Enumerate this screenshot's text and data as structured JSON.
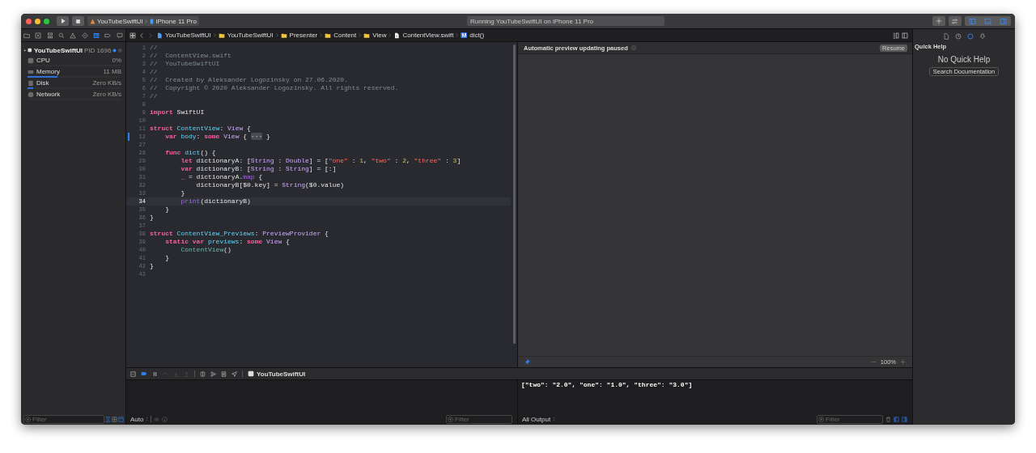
{
  "toolbar": {
    "scheme": {
      "target": "YouTubeSwiftUI",
      "device": "iPhone 11 Pro"
    },
    "activity": "Running YouTubeSwiftUI on iPhone 11 Pro",
    "panel_toggles": [
      {
        "kind": "left",
        "selected": true
      },
      {
        "kind": "bottom",
        "selected": true
      },
      {
        "kind": "right",
        "selected": true
      }
    ]
  },
  "navigator": {
    "tabs": [
      {
        "kind": "folder",
        "selected": false
      },
      {
        "kind": "source",
        "selected": false
      },
      {
        "kind": "symbol",
        "selected": false
      },
      {
        "kind": "search",
        "selected": false
      },
      {
        "kind": "issue",
        "selected": false
      },
      {
        "kind": "test",
        "selected": false
      },
      {
        "kind": "debug",
        "selected": true
      },
      {
        "kind": "breakpoint",
        "selected": false
      },
      {
        "kind": "report",
        "selected": false
      }
    ],
    "process": {
      "name": "YouTubeSwiftUI",
      "pid": "PID 1696"
    },
    "gauges": [
      {
        "kind": "cpu",
        "label": "CPU",
        "value": "0%"
      },
      {
        "kind": "memory",
        "label": "Memory",
        "value": "11 MB",
        "level": 0.32
      },
      {
        "kind": "disk",
        "label": "Disk",
        "value": "Zero KB/s",
        "level": 0.06
      },
      {
        "kind": "network",
        "label": "Network",
        "value": "Zero KB/s"
      }
    ],
    "filter": {
      "placeholder": "Filter"
    },
    "filter_toggles": [
      {
        "kind": "running",
        "selected": true
      },
      {
        "kind": "grid",
        "selected": false
      },
      {
        "kind": "window",
        "selected": true
      }
    ]
  },
  "editor": {
    "jump_bar": [
      {
        "kind": "project",
        "label": "YouTubeSwiftUI"
      },
      {
        "kind": "folder",
        "label": "YouTubeSwiftUI"
      },
      {
        "kind": "folder",
        "label": "Presenter"
      },
      {
        "kind": "folder",
        "label": "Content"
      },
      {
        "kind": "folder",
        "label": "View"
      },
      {
        "kind": "file",
        "label": "ContentView.swift"
      },
      {
        "kind": "method",
        "badge": "M",
        "label": "dict()"
      }
    ],
    "lines": [
      {
        "n": "1",
        "current": false,
        "changed": false,
        "tokens": [
          {
            "kind": "comment",
            "text": "//"
          }
        ]
      },
      {
        "n": "2",
        "current": false,
        "changed": false,
        "tokens": [
          {
            "kind": "comment",
            "text": "//  ContentView.swift"
          }
        ]
      },
      {
        "n": "3",
        "current": false,
        "changed": false,
        "tokens": [
          {
            "kind": "comment",
            "text": "//  YouTubeSwiftUI"
          }
        ]
      },
      {
        "n": "4",
        "current": false,
        "changed": false,
        "tokens": [
          {
            "kind": "comment",
            "text": "//"
          }
        ]
      },
      {
        "n": "5",
        "current": false,
        "changed": false,
        "tokens": [
          {
            "kind": "comment",
            "text": "//  Created by Aleksander Logozinsky on 27.06.2020."
          }
        ]
      },
      {
        "n": "6",
        "current": false,
        "changed": false,
        "tokens": [
          {
            "kind": "comment",
            "text": "//  Copyright © 2020 Aleksander Logozinsky. All rights reserved."
          }
        ]
      },
      {
        "n": "7",
        "current": false,
        "changed": false,
        "tokens": [
          {
            "kind": "comment",
            "text": "//"
          }
        ]
      },
      {
        "n": "8",
        "current": false,
        "changed": false
      },
      {
        "n": "9",
        "current": false,
        "changed": false,
        "tokens": [
          {
            "kind": "keyword",
            "text": "import "
          },
          {
            "kind": "plain",
            "text": "SwiftUI"
          }
        ]
      },
      {
        "n": "10",
        "current": false,
        "changed": false
      },
      {
        "n": "11",
        "current": false,
        "changed": false,
        "tokens": [
          {
            "kind": "keyword",
            "text": "struct "
          },
          {
            "kind": "decl",
            "text": "ContentView"
          },
          {
            "kind": "plain",
            "text": ": "
          },
          {
            "kind": "type",
            "text": "View"
          },
          {
            "kind": "plain",
            "text": " {"
          }
        ]
      },
      {
        "n": "12",
        "current": false,
        "changed": true,
        "tokens": [
          {
            "kind": "keyword",
            "text": "    var "
          },
          {
            "kind": "decl",
            "text": "body"
          },
          {
            "kind": "plain",
            "text": ": "
          },
          {
            "kind": "keyword",
            "text": "some "
          },
          {
            "kind": "type",
            "text": "View"
          },
          {
            "kind": "plain",
            "text": " { "
          },
          {
            "kind": "fold",
            "text": "···"
          },
          {
            "kind": "plain",
            "text": " }"
          }
        ]
      },
      {
        "n": "27",
        "current": false,
        "changed": false
      },
      {
        "n": "28",
        "current": false,
        "changed": false,
        "tokens": [
          {
            "kind": "keyword",
            "text": "    func "
          },
          {
            "kind": "decl",
            "text": "dict"
          },
          {
            "kind": "plain",
            "text": "() {"
          }
        ]
      },
      {
        "n": "29",
        "current": false,
        "changed": false,
        "tokens": [
          {
            "kind": "keyword",
            "text": "        let "
          },
          {
            "kind": "plain",
            "text": "dictionaryA: ["
          },
          {
            "kind": "type",
            "text": "String"
          },
          {
            "kind": "plain",
            "text": " : "
          },
          {
            "kind": "type",
            "text": "Double"
          },
          {
            "kind": "plain",
            "text": "] = ["
          },
          {
            "kind": "string",
            "text": "\"one\""
          },
          {
            "kind": "plain",
            "text": " : "
          },
          {
            "kind": "number",
            "text": "1"
          },
          {
            "kind": "plain",
            "text": ", "
          },
          {
            "kind": "string",
            "text": "\"two\""
          },
          {
            "kind": "plain",
            "text": " : "
          },
          {
            "kind": "number",
            "text": "2"
          },
          {
            "kind": "plain",
            "text": ", "
          },
          {
            "kind": "string",
            "text": "\"three\""
          },
          {
            "kind": "plain",
            "text": " : "
          },
          {
            "kind": "number",
            "text": "3"
          },
          {
            "kind": "plain",
            "text": "]"
          }
        ]
      },
      {
        "n": "30",
        "current": false,
        "changed": false,
        "tokens": [
          {
            "kind": "keyword",
            "text": "        var "
          },
          {
            "kind": "plain",
            "text": "dictionaryB: ["
          },
          {
            "kind": "type",
            "text": "String"
          },
          {
            "kind": "plain",
            "text": " : "
          },
          {
            "kind": "type",
            "text": "String"
          },
          {
            "kind": "plain",
            "text": "] = [:]"
          }
        ]
      },
      {
        "n": "31",
        "current": false,
        "changed": false,
        "tokens": [
          {
            "kind": "keyword",
            "text": "        _"
          },
          {
            "kind": "plain",
            "text": " = dictionaryA."
          },
          {
            "kind": "call",
            "text": "map"
          },
          {
            "kind": "plain",
            "text": " {"
          }
        ]
      },
      {
        "n": "32",
        "current": false,
        "changed": false,
        "tokens": [
          {
            "kind": "plain",
            "text": "            dictionaryB[$0.key] = "
          },
          {
            "kind": "type",
            "text": "String"
          },
          {
            "kind": "plain",
            "text": "($0.value)"
          }
        ]
      },
      {
        "n": "33",
        "current": false,
        "changed": false,
        "tokens": [
          {
            "kind": "plain",
            "text": "        }"
          }
        ]
      },
      {
        "n": "34",
        "current": true,
        "changed": false,
        "tokens": [
          {
            "kind": "call",
            "text": "        print"
          },
          {
            "kind": "plain",
            "text": "(dictionaryB)"
          }
        ]
      },
      {
        "n": "35",
        "current": false,
        "changed": false,
        "tokens": [
          {
            "kind": "plain",
            "text": "    }"
          }
        ]
      },
      {
        "n": "36",
        "current": false,
        "changed": false,
        "tokens": [
          {
            "kind": "plain",
            "text": "}"
          }
        ]
      },
      {
        "n": "37",
        "current": false,
        "changed": false
      },
      {
        "n": "38",
        "current": false,
        "changed": false,
        "tokens": [
          {
            "kind": "keyword",
            "text": "struct "
          },
          {
            "kind": "decl",
            "text": "ContentView_Previews"
          },
          {
            "kind": "plain",
            "text": ": "
          },
          {
            "kind": "type",
            "text": "PreviewProvider"
          },
          {
            "kind": "plain",
            "text": " {"
          }
        ]
      },
      {
        "n": "39",
        "current": false,
        "changed": false,
        "tokens": [
          {
            "kind": "keyword",
            "text": "    static var "
          },
          {
            "kind": "decl",
            "text": "previews"
          },
          {
            "kind": "plain",
            "text": ": "
          },
          {
            "kind": "keyword",
            "text": "some "
          },
          {
            "kind": "type",
            "text": "View"
          },
          {
            "kind": "plain",
            "text": " {"
          }
        ]
      },
      {
        "n": "40",
        "current": false,
        "changed": false,
        "tokens": [
          {
            "kind": "project",
            "text": "        ContentView"
          },
          {
            "kind": "plain",
            "text": "()"
          }
        ]
      },
      {
        "n": "41",
        "current": false,
        "changed": false,
        "tokens": [
          {
            "kind": "plain",
            "text": "    }"
          }
        ]
      },
      {
        "n": "42",
        "current": false,
        "changed": false,
        "tokens": [
          {
            "kind": "plain",
            "text": "}"
          }
        ]
      },
      {
        "n": "43",
        "current": false,
        "changed": false
      }
    ]
  },
  "preview": {
    "status": "Automatic preview updating paused",
    "resume": "Resume",
    "zoom": "100%",
    "pinned": true
  },
  "debug_bar": {
    "breakpoints_active": true,
    "target": "YouTubeSwiftUI"
  },
  "variables": {
    "scope": "Auto",
    "filter": {
      "placeholder": "Filter"
    }
  },
  "console": {
    "output": "[\"two\": \"2.0\", \"one\": \"1.0\", \"three\": \"3.0\"]",
    "scope": "All Output",
    "filter": {
      "placeholder": "Filter"
    },
    "view_toggles": [
      {
        "kind": "variables",
        "selected": true
      },
      {
        "kind": "console",
        "selected": true
      }
    ]
  },
  "inspector": {
    "tabs": [
      {
        "kind": "file",
        "selected": false
      },
      {
        "kind": "history",
        "selected": false
      },
      {
        "kind": "help",
        "selected": true
      },
      {
        "kind": "library",
        "selected": false
      }
    ],
    "title": "Quick Help",
    "empty": "No Quick Help",
    "button": "Search Documentation"
  }
}
